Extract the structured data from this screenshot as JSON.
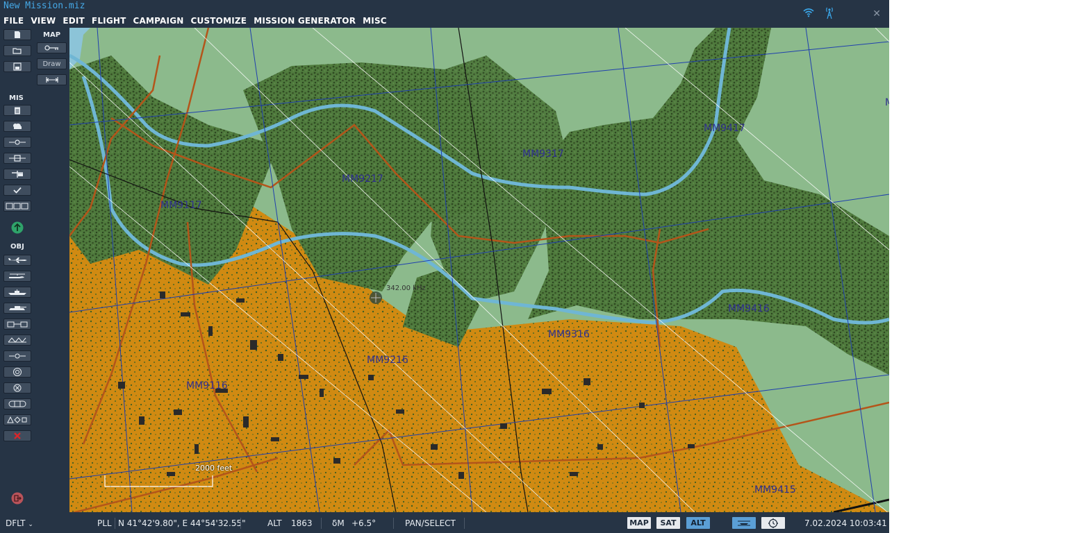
{
  "window": {
    "title": "New Mission.miz"
  },
  "menu": [
    "FILE",
    "VIEW",
    "EDIT",
    "FLIGHT",
    "CAMPAIGN",
    "CUSTOMIZE",
    "MISSION GENERATOR",
    "MISC"
  ],
  "toolbar": {
    "map_label": "MAP",
    "draw_label": "Draw",
    "mis_label": "MIS",
    "obj_label": "OBJ"
  },
  "map": {
    "grid_labels": [
      "MM9117",
      "MM9217",
      "MM9317",
      "MM9417",
      "MM9116",
      "MM9216",
      "MM9316",
      "MM9416",
      "MM9415"
    ],
    "edge_label": "M",
    "beacon_label": "342.00 kHz",
    "scale_label": "2000 feet",
    "colors": {
      "grass": "#8cba8c",
      "forest": "#4f7a3d",
      "urban": "#d08a12",
      "river": "#6fb6d4",
      "road": "#b4551a",
      "grid": "#1f3fae"
    }
  },
  "status": {
    "profile": "DFLT",
    "coord_label": "PLL",
    "coords": "N 41°42'9.80\", E 44°54'32.55\"",
    "alt_label": "ALT",
    "alt_value": "1863",
    "mag_label": "δM",
    "mag_value": "+6.5°",
    "mode": "PAN/SELECT",
    "view_buttons": [
      "MAP",
      "SAT",
      "ALT"
    ],
    "active_view": "ALT",
    "datetime": "7.02.2024 10:03:41"
  }
}
